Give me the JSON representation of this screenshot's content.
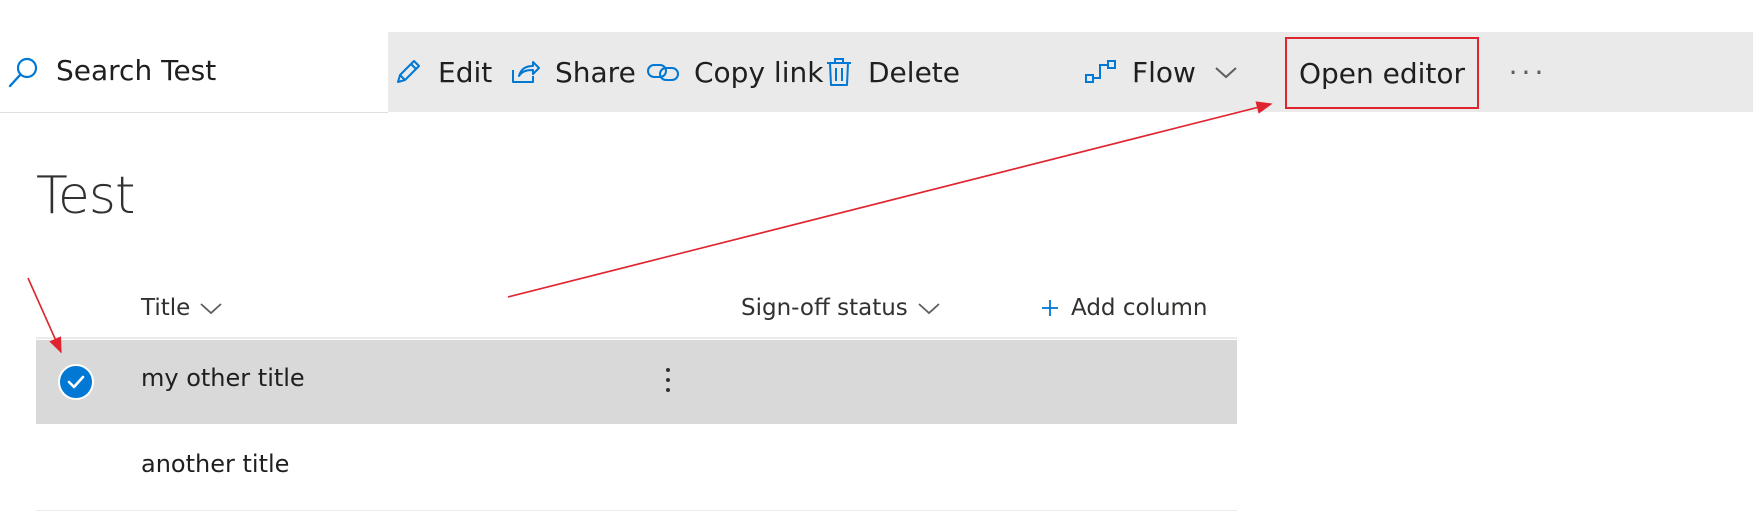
{
  "search": {
    "label": "Search Test",
    "icon": "search-icon"
  },
  "commandbar": {
    "edit": "Edit",
    "share": "Share",
    "copy_link": "Copy link",
    "delete": "Delete",
    "flow": "Flow",
    "open_editor": "Open editor",
    "more": "···"
  },
  "page": {
    "title": "Test"
  },
  "list": {
    "columns": {
      "title": "Title",
      "signoff": "Sign-off status",
      "add_column": "Add column"
    },
    "rows": [
      {
        "title": "my other title",
        "selected": true
      },
      {
        "title": "another title",
        "selected": false
      }
    ]
  },
  "colors": {
    "accent": "#0078d4",
    "annotation": "#e0242f",
    "command_bar_bg": "#eaeaea",
    "selected_row_bg": "#d9d9d9"
  }
}
